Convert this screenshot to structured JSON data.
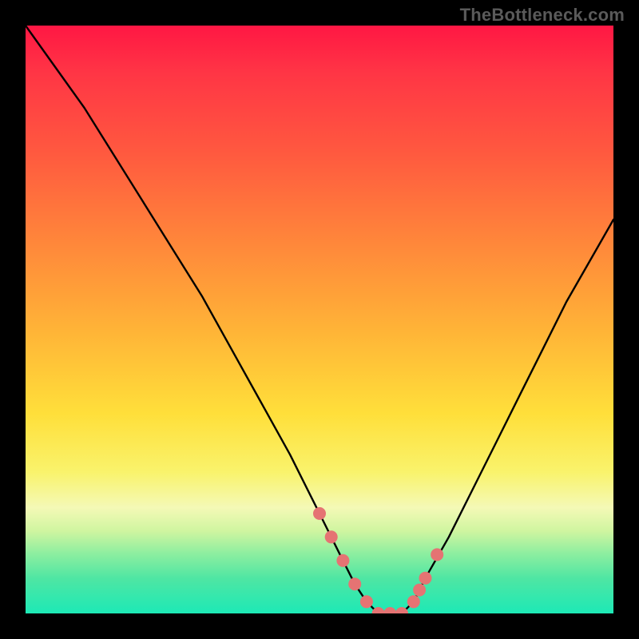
{
  "attribution": "TheBottleneck.com",
  "chart_data": {
    "type": "line",
    "title": "",
    "xlabel": "",
    "ylabel": "",
    "xlim": [
      0,
      100
    ],
    "ylim": [
      0,
      100
    ],
    "grid": false,
    "legend": false,
    "series": [
      {
        "name": "bottleneck-curve",
        "color": "#000000",
        "x": [
          0,
          5,
          10,
          15,
          20,
          25,
          30,
          35,
          40,
          45,
          50,
          52,
          54,
          56,
          58,
          60,
          62,
          64,
          66,
          68,
          72,
          76,
          80,
          84,
          88,
          92,
          96,
          100
        ],
        "values": [
          100,
          93,
          86,
          78,
          70,
          62,
          54,
          45,
          36,
          27,
          17,
          13,
          9,
          5,
          2,
          0,
          0,
          0,
          2,
          6,
          13,
          21,
          29,
          37,
          45,
          53,
          60,
          67
        ]
      }
    ],
    "markers": [
      {
        "name": "left-marker-1",
        "x": 50,
        "y": 17,
        "color": "#e57373"
      },
      {
        "name": "left-marker-2",
        "x": 52,
        "y": 13,
        "color": "#e57373"
      },
      {
        "name": "left-marker-3",
        "x": 54,
        "y": 9,
        "color": "#e57373"
      },
      {
        "name": "left-marker-4",
        "x": 56,
        "y": 5,
        "color": "#e57373"
      },
      {
        "name": "flat-marker-1",
        "x": 58,
        "y": 2,
        "color": "#e57373"
      },
      {
        "name": "flat-marker-2",
        "x": 60,
        "y": 0,
        "color": "#e57373"
      },
      {
        "name": "flat-marker-3",
        "x": 62,
        "y": 0,
        "color": "#e57373"
      },
      {
        "name": "flat-marker-4",
        "x": 64,
        "y": 0,
        "color": "#e57373"
      },
      {
        "name": "right-marker-1",
        "x": 66,
        "y": 2,
        "color": "#e57373"
      },
      {
        "name": "right-marker-2",
        "x": 67,
        "y": 4,
        "color": "#e57373"
      },
      {
        "name": "right-marker-3",
        "x": 68,
        "y": 6,
        "color": "#e57373"
      },
      {
        "name": "right-marker-4",
        "x": 70,
        "y": 10,
        "color": "#e57373"
      }
    ],
    "gradient_stops": [
      {
        "pos": 0,
        "color": "#ff1744"
      },
      {
        "pos": 8,
        "color": "#ff3545"
      },
      {
        "pos": 22,
        "color": "#ff5a3f"
      },
      {
        "pos": 38,
        "color": "#ff8a3a"
      },
      {
        "pos": 52,
        "color": "#ffb437"
      },
      {
        "pos": 66,
        "color": "#ffdf3a"
      },
      {
        "pos": 76,
        "color": "#f9f36c"
      },
      {
        "pos": 82,
        "color": "#f4f9b6"
      },
      {
        "pos": 86,
        "color": "#cff5a0"
      },
      {
        "pos": 90,
        "color": "#8aeea0"
      },
      {
        "pos": 94,
        "color": "#4fe6a3"
      },
      {
        "pos": 100,
        "color": "#1de9b6"
      }
    ]
  }
}
